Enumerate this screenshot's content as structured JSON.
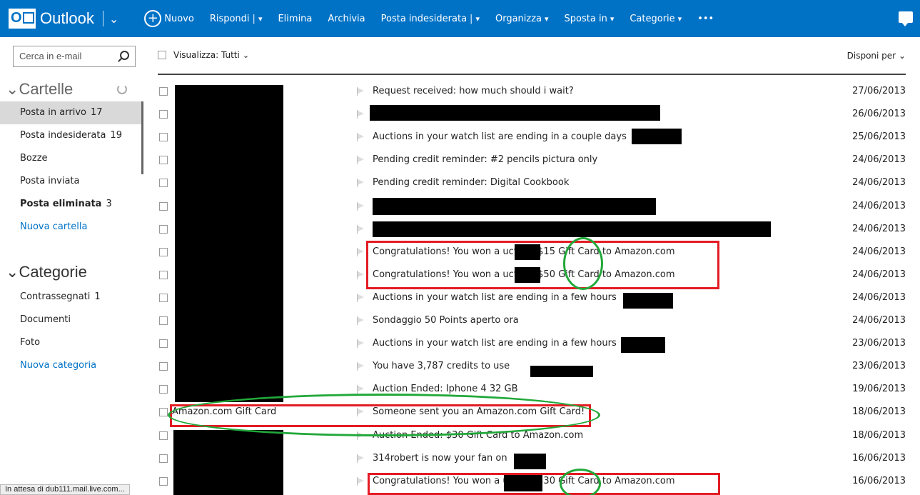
{
  "topbar": {
    "logo_text": "Outlook",
    "commands": [
      {
        "label": "Nuovo"
      },
      {
        "label": "Rispondi",
        "dropdown": true
      },
      {
        "label": "Elimina"
      },
      {
        "label": "Archivia"
      },
      {
        "label": "Posta indesiderata",
        "dropdown": true
      },
      {
        "label": "Organizza",
        "dropdown": true
      },
      {
        "label": "Sposta in",
        "dropdown": true
      },
      {
        "label": "Categorie",
        "dropdown": true
      },
      {
        "label": "•••"
      }
    ]
  },
  "sidebar": {
    "search_placeholder": "Cerca in e-mail",
    "folders_title": "Cartelle",
    "folders": [
      {
        "label": "Posta in arrivo",
        "count": "17"
      },
      {
        "label": "Posta indesiderata",
        "count": "19"
      },
      {
        "label": "Bozze",
        "count": ""
      },
      {
        "label": "Posta inviata",
        "count": ""
      },
      {
        "label": "Posta eliminata",
        "count": "3"
      },
      {
        "label": "Nuova cartella",
        "count": ""
      }
    ],
    "categories_title": "Categorie",
    "categories": [
      {
        "label": "Contrassegnati",
        "count": "1"
      },
      {
        "label": "Documenti",
        "count": ""
      },
      {
        "label": "Foto",
        "count": ""
      },
      {
        "label": "Nuova categoria",
        "count": ""
      }
    ]
  },
  "list": {
    "view_label": "Visualizza: Tutti",
    "sort_label": "Disponi per",
    "emails": [
      {
        "sender": "",
        "subject": "Request received: how much should i wait?",
        "date": "27/06/2013"
      },
      {
        "sender": "",
        "subject": "",
        "date": "26/06/2013"
      },
      {
        "sender": "",
        "subject": "Auctions in your watch list are ending in a couple days",
        "date": "25/06/2013"
      },
      {
        "sender": "",
        "subject": "Pending credit reminder: #2 pencils pictura only",
        "date": "24/06/2013"
      },
      {
        "sender": "",
        "subject": "Pending credit reminder: Digital Cookbook",
        "date": "24/06/2013"
      },
      {
        "sender": "",
        "subject": "",
        "date": "24/06/2013"
      },
      {
        "sender": "",
        "subject": "",
        "date": "24/06/2013"
      },
      {
        "sender": "",
        "subject": "Congratulations! You won a          uction: $15 Gift Card to Amazon.com",
        "date": "24/06/2013"
      },
      {
        "sender": "",
        "subject": "Congratulations! You won a          uction: $50 Gift Card to Amazon.com",
        "date": "24/06/2013"
      },
      {
        "sender": "",
        "subject": "Auctions in your watch list are ending in a few hours",
        "date": "24/06/2013"
      },
      {
        "sender": "",
        "subject": "Sondaggio 50 Points aperto ora",
        "date": "24/06/2013"
      },
      {
        "sender": "",
        "subject": "Auctions in your watch list are ending in a few hours",
        "date": "23/06/2013"
      },
      {
        "sender": "",
        "subject": "You have 3,787 credits to use",
        "date": "23/06/2013"
      },
      {
        "sender": "",
        "subject": "Auction Ended: Iphone 4 32 GB",
        "date": "19/06/2013"
      },
      {
        "sender": "Amazon.com Gift Card",
        "subject": "Someone sent you an Amazon.com Gift Card!",
        "date": "18/06/2013"
      },
      {
        "sender": "",
        "subject": "Auction Ended: $30 Gift Card to Amazon.com",
        "date": "18/06/2013"
      },
      {
        "sender": "",
        "subject": "314robert is now your fan on",
        "date": "16/06/2013"
      },
      {
        "sender": "",
        "subject": "Congratulations! You won a          uction: $30 Gift Card to Amazon.com",
        "date": "16/06/2013"
      }
    ]
  },
  "status_text": "In attesa di dub111.mail.live.com...",
  "colors": {
    "brand": "#0072c6",
    "annotation_red": "#e31b23",
    "annotation_green": "#22a83a",
    "redaction": "#000000"
  }
}
